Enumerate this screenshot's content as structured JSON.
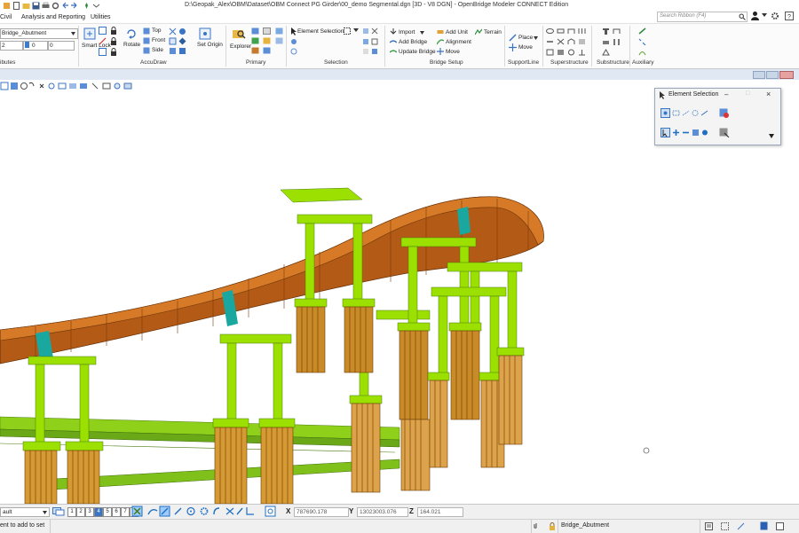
{
  "window": {
    "title": "D:\\Geopak_Alex\\OBM\\Dataset\\OBM Connect PG Girder\\00_demo Segmental.dgn [3D - V8 DGN] - OpenBridge Modeler CONNECT Edition",
    "search_placeholder": "Search Ribbon (F4)"
  },
  "tabs": [
    "Civil",
    "Analysis and Reporting",
    "Utilities"
  ],
  "ribbon": {
    "attributes": {
      "level": "Bridge_Abutment",
      "weight": "2",
      "color": "0",
      "style": "0",
      "group": "Attributes"
    },
    "accudraw": {
      "smart_lock": "Smart Lock",
      "rotate": "Rotate",
      "top": "Top",
      "front": "Front",
      "side": "Side",
      "set_origin": "Set Origin",
      "group": "AccuDraw"
    },
    "primary": {
      "explorer": "Explorer",
      "group": "Primary"
    },
    "selection": {
      "element_selection": "Element Selection",
      "group": "Selection"
    },
    "bridge_setup": {
      "import": "Import",
      "add_bridge": "Add Bridge",
      "update_bridge": "Update Bridge",
      "add_unit": "Add Unit",
      "alignment": "Alignment",
      "move": "Move",
      "terrain": "Terrain",
      "group": "Bridge Setup"
    },
    "supportline": {
      "place": "Place",
      "move": "Move",
      "group": "SupportLine"
    },
    "superstructure": {
      "group": "Superstructure"
    },
    "substructure": {
      "group": "Substructure"
    },
    "auxiliary": {
      "group": "Auxiliary"
    }
  },
  "dialog": {
    "title": "Element Selection"
  },
  "bottom": {
    "view_combo": "ault",
    "views": [
      "1",
      "2",
      "3",
      "4",
      "5",
      "6",
      "7",
      "8"
    ],
    "x_label": "X",
    "x_value": "787690.178",
    "y_label": "Y",
    "y_value": "13023003.076",
    "z_label": "Z",
    "z_value": "164.021"
  },
  "status": {
    "prompt": "ent to add to set",
    "level": "Bridge_Abutment"
  },
  "colors": {
    "girder": "#b35a16",
    "pier": "#9be000",
    "piles": "#d59a34",
    "accent": "#1f6fc2",
    "bearing_band": "#19a7a0"
  }
}
